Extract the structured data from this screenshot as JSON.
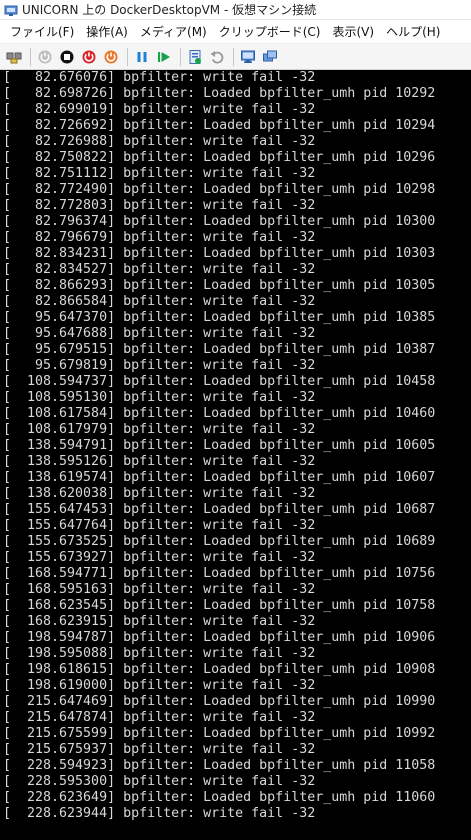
{
  "window": {
    "title": "UNICORN 上の DockerDesktopVM - 仮想マシン接続",
    "icon": "vm-connect-icon"
  },
  "menu": [
    {
      "id": "file",
      "label": "ファイル(F)"
    },
    {
      "id": "action",
      "label": "操作(A)"
    },
    {
      "id": "media",
      "label": "メディア(M)"
    },
    {
      "id": "clipboard",
      "label": "クリップボード(C)"
    },
    {
      "id": "view",
      "label": "表示(V)"
    },
    {
      "id": "help",
      "label": "ヘルプ(H)"
    }
  ],
  "toolbar": [
    {
      "id": "ctrl-alt-del",
      "icon": "ctrl-alt-del-icon"
    },
    {
      "sep": true
    },
    {
      "id": "start",
      "icon": "start-icon"
    },
    {
      "id": "turn-off",
      "icon": "turn-off-icon"
    },
    {
      "id": "shut-down",
      "icon": "shut-down-icon"
    },
    {
      "id": "power",
      "icon": "power-icon"
    },
    {
      "sep": true
    },
    {
      "id": "pause",
      "icon": "pause-icon"
    },
    {
      "id": "resume",
      "icon": "resume-icon"
    },
    {
      "sep": true
    },
    {
      "id": "checkpoint",
      "icon": "checkpoint-icon"
    },
    {
      "id": "revert",
      "icon": "revert-icon"
    },
    {
      "sep": true
    },
    {
      "id": "enhanced-session",
      "icon": "enhanced-session-icon"
    },
    {
      "id": "share",
      "icon": "share-icon"
    }
  ],
  "colors": {
    "console_bg": "#000000",
    "console_text": "#d8d8d8",
    "power_red": "#d9262b",
    "power_orange": "#e8792b",
    "media_blue": "#1e7fd6",
    "media_green": "#17a34a"
  },
  "console_lines": [
    "[   82.676076] bpfilter: write fail -32",
    "[   82.698726] bpfilter: Loaded bpfilter_umh pid 10292",
    "[   82.699019] bpfilter: write fail -32",
    "[   82.726692] bpfilter: Loaded bpfilter_umh pid 10294",
    "[   82.726988] bpfilter: write fail -32",
    "[   82.750822] bpfilter: Loaded bpfilter_umh pid 10296",
    "[   82.751112] bpfilter: write fail -32",
    "[   82.772490] bpfilter: Loaded bpfilter_umh pid 10298",
    "[   82.772803] bpfilter: write fail -32",
    "[   82.796374] bpfilter: Loaded bpfilter_umh pid 10300",
    "[   82.796679] bpfilter: write fail -32",
    "[   82.834231] bpfilter: Loaded bpfilter_umh pid 10303",
    "[   82.834527] bpfilter: write fail -32",
    "[   82.866293] bpfilter: Loaded bpfilter_umh pid 10305",
    "[   82.866584] bpfilter: write fail -32",
    "[   95.647370] bpfilter: Loaded bpfilter_umh pid 10385",
    "[   95.647688] bpfilter: write fail -32",
    "[   95.679515] bpfilter: Loaded bpfilter_umh pid 10387",
    "[   95.679819] bpfilter: write fail -32",
    "[  108.594737] bpfilter: Loaded bpfilter_umh pid 10458",
    "[  108.595130] bpfilter: write fail -32",
    "[  108.617584] bpfilter: Loaded bpfilter_umh pid 10460",
    "[  108.617979] bpfilter: write fail -32",
    "[  138.594791] bpfilter: Loaded bpfilter_umh pid 10605",
    "[  138.595126] bpfilter: write fail -32",
    "[  138.619574] bpfilter: Loaded bpfilter_umh pid 10607",
    "[  138.620038] bpfilter: write fail -32",
    "[  155.647453] bpfilter: Loaded bpfilter_umh pid 10687",
    "[  155.647764] bpfilter: write fail -32",
    "[  155.673525] bpfilter: Loaded bpfilter_umh pid 10689",
    "[  155.673927] bpfilter: write fail -32",
    "[  168.594771] bpfilter: Loaded bpfilter_umh pid 10756",
    "[  168.595163] bpfilter: write fail -32",
    "[  168.623545] bpfilter: Loaded bpfilter_umh pid 10758",
    "[  168.623915] bpfilter: write fail -32",
    "[  198.594787] bpfilter: Loaded bpfilter_umh pid 10906",
    "[  198.595088] bpfilter: write fail -32",
    "[  198.618615] bpfilter: Loaded bpfilter_umh pid 10908",
    "[  198.619000] bpfilter: write fail -32",
    "[  215.647469] bpfilter: Loaded bpfilter_umh pid 10990",
    "[  215.647874] bpfilter: write fail -32",
    "[  215.675599] bpfilter: Loaded bpfilter_umh pid 10992",
    "[  215.675937] bpfilter: write fail -32",
    "[  228.594923] bpfilter: Loaded bpfilter_umh pid 11058",
    "[  228.595300] bpfilter: write fail -32",
    "[  228.623649] bpfilter: Loaded bpfilter_umh pid 11060",
    "[  228.623944] bpfilter: write fail -32"
  ]
}
